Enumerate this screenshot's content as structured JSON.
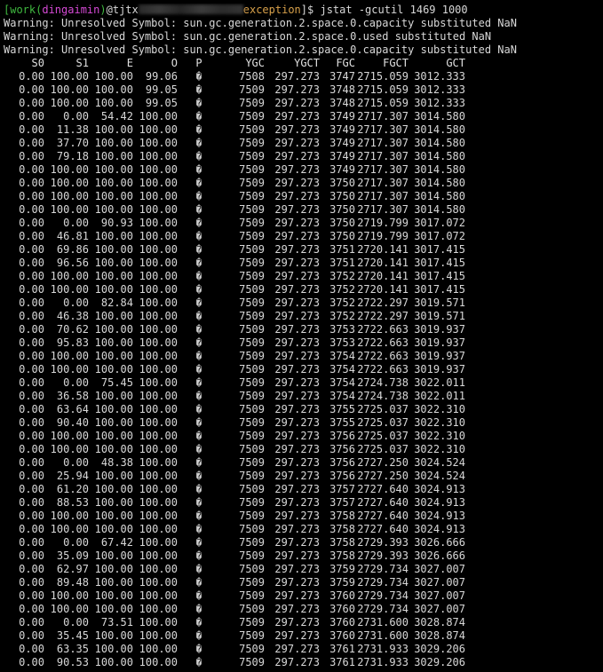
{
  "prompt": {
    "bracket_open": "[",
    "dir_a": "work(",
    "user": "dingaimin",
    "close_paren": ")",
    "at_host": "@tjtx",
    "dir_b": "exception",
    "bracket_close": "]$ ",
    "command": "jstat -gcutil 1469 1000"
  },
  "warnings": [
    "Warning: Unresolved Symbol: sun.gc.generation.2.space.0.capacity substituted NaN",
    "Warning: Unresolved Symbol: sun.gc.generation.2.space.0.used substituted NaN",
    "Warning: Unresolved Symbol: sun.gc.generation.2.space.0.capacity substituted NaN"
  ],
  "columns": [
    "S0",
    "S1",
    "E",
    "O",
    "P",
    "YGC",
    "YGCT",
    "FGC",
    "FGCT",
    "GCT"
  ],
  "p_glyph": "�",
  "rows": [
    [
      "0.00",
      "100.00",
      "100.00",
      "99.06",
      "7508",
      "297.273",
      "3747",
      "2715.059",
      "3012.333"
    ],
    [
      "0.00",
      "100.00",
      "100.00",
      "99.05",
      "7509",
      "297.273",
      "3748",
      "2715.059",
      "3012.333"
    ],
    [
      "0.00",
      "100.00",
      "100.00",
      "99.05",
      "7509",
      "297.273",
      "3748",
      "2715.059",
      "3012.333"
    ],
    [
      "0.00",
      "0.00",
      "54.42",
      "100.00",
      "7509",
      "297.273",
      "3749",
      "2717.307",
      "3014.580"
    ],
    [
      "0.00",
      "11.38",
      "100.00",
      "100.00",
      "7509",
      "297.273",
      "3749",
      "2717.307",
      "3014.580"
    ],
    [
      "0.00",
      "37.70",
      "100.00",
      "100.00",
      "7509",
      "297.273",
      "3749",
      "2717.307",
      "3014.580"
    ],
    [
      "0.00",
      "79.18",
      "100.00",
      "100.00",
      "7509",
      "297.273",
      "3749",
      "2717.307",
      "3014.580"
    ],
    [
      "0.00",
      "100.00",
      "100.00",
      "100.00",
      "7509",
      "297.273",
      "3749",
      "2717.307",
      "3014.580"
    ],
    [
      "0.00",
      "100.00",
      "100.00",
      "100.00",
      "7509",
      "297.273",
      "3750",
      "2717.307",
      "3014.580"
    ],
    [
      "0.00",
      "100.00",
      "100.00",
      "100.00",
      "7509",
      "297.273",
      "3750",
      "2717.307",
      "3014.580"
    ],
    [
      "0.00",
      "100.00",
      "100.00",
      "100.00",
      "7509",
      "297.273",
      "3750",
      "2717.307",
      "3014.580"
    ],
    [
      "0.00",
      "0.00",
      "90.93",
      "100.00",
      "7509",
      "297.273",
      "3750",
      "2719.799",
      "3017.072"
    ],
    [
      "0.00",
      "46.81",
      "100.00",
      "100.00",
      "7509",
      "297.273",
      "3750",
      "2719.799",
      "3017.072"
    ],
    [
      "0.00",
      "69.86",
      "100.00",
      "100.00",
      "7509",
      "297.273",
      "3751",
      "2720.141",
      "3017.415"
    ],
    [
      "0.00",
      "96.56",
      "100.00",
      "100.00",
      "7509",
      "297.273",
      "3751",
      "2720.141",
      "3017.415"
    ],
    [
      "0.00",
      "100.00",
      "100.00",
      "100.00",
      "7509",
      "297.273",
      "3752",
      "2720.141",
      "3017.415"
    ],
    [
      "0.00",
      "100.00",
      "100.00",
      "100.00",
      "7509",
      "297.273",
      "3752",
      "2720.141",
      "3017.415"
    ],
    [
      "0.00",
      "0.00",
      "82.84",
      "100.00",
      "7509",
      "297.273",
      "3752",
      "2722.297",
      "3019.571"
    ],
    [
      "0.00",
      "46.38",
      "100.00",
      "100.00",
      "7509",
      "297.273",
      "3752",
      "2722.297",
      "3019.571"
    ],
    [
      "0.00",
      "70.62",
      "100.00",
      "100.00",
      "7509",
      "297.273",
      "3753",
      "2722.663",
      "3019.937"
    ],
    [
      "0.00",
      "95.83",
      "100.00",
      "100.00",
      "7509",
      "297.273",
      "3753",
      "2722.663",
      "3019.937"
    ],
    [
      "0.00",
      "100.00",
      "100.00",
      "100.00",
      "7509",
      "297.273",
      "3754",
      "2722.663",
      "3019.937"
    ],
    [
      "0.00",
      "100.00",
      "100.00",
      "100.00",
      "7509",
      "297.273",
      "3754",
      "2722.663",
      "3019.937"
    ],
    [
      "0.00",
      "0.00",
      "75.45",
      "100.00",
      "7509",
      "297.273",
      "3754",
      "2724.738",
      "3022.011"
    ],
    [
      "0.00",
      "36.58",
      "100.00",
      "100.00",
      "7509",
      "297.273",
      "3754",
      "2724.738",
      "3022.011"
    ],
    [
      "0.00",
      "63.64",
      "100.00",
      "100.00",
      "7509",
      "297.273",
      "3755",
      "2725.037",
      "3022.310"
    ],
    [
      "0.00",
      "90.40",
      "100.00",
      "100.00",
      "7509",
      "297.273",
      "3755",
      "2725.037",
      "3022.310"
    ],
    [
      "0.00",
      "100.00",
      "100.00",
      "100.00",
      "7509",
      "297.273",
      "3756",
      "2725.037",
      "3022.310"
    ],
    [
      "0.00",
      "100.00",
      "100.00",
      "100.00",
      "7509",
      "297.273",
      "3756",
      "2725.037",
      "3022.310"
    ],
    [
      "0.00",
      "0.00",
      "48.38",
      "100.00",
      "7509",
      "297.273",
      "3756",
      "2727.250",
      "3024.524"
    ],
    [
      "0.00",
      "25.94",
      "100.00",
      "100.00",
      "7509",
      "297.273",
      "3756",
      "2727.250",
      "3024.524"
    ],
    [
      "0.00",
      "61.20",
      "100.00",
      "100.00",
      "7509",
      "297.273",
      "3757",
      "2727.640",
      "3024.913"
    ],
    [
      "0.00",
      "88.53",
      "100.00",
      "100.00",
      "7509",
      "297.273",
      "3757",
      "2727.640",
      "3024.913"
    ],
    [
      "0.00",
      "100.00",
      "100.00",
      "100.00",
      "7509",
      "297.273",
      "3758",
      "2727.640",
      "3024.913"
    ],
    [
      "0.00",
      "100.00",
      "100.00",
      "100.00",
      "7509",
      "297.273",
      "3758",
      "2727.640",
      "3024.913"
    ],
    [
      "0.00",
      "0.00",
      "67.42",
      "100.00",
      "7509",
      "297.273",
      "3758",
      "2729.393",
      "3026.666"
    ],
    [
      "0.00",
      "35.09",
      "100.00",
      "100.00",
      "7509",
      "297.273",
      "3758",
      "2729.393",
      "3026.666"
    ],
    [
      "0.00",
      "62.97",
      "100.00",
      "100.00",
      "7509",
      "297.273",
      "3759",
      "2729.734",
      "3027.007"
    ],
    [
      "0.00",
      "89.48",
      "100.00",
      "100.00",
      "7509",
      "297.273",
      "3759",
      "2729.734",
      "3027.007"
    ],
    [
      "0.00",
      "100.00",
      "100.00",
      "100.00",
      "7509",
      "297.273",
      "3760",
      "2729.734",
      "3027.007"
    ],
    [
      "0.00",
      "100.00",
      "100.00",
      "100.00",
      "7509",
      "297.273",
      "3760",
      "2729.734",
      "3027.007"
    ],
    [
      "0.00",
      "0.00",
      "73.51",
      "100.00",
      "7509",
      "297.273",
      "3760",
      "2731.600",
      "3028.874"
    ],
    [
      "0.00",
      "35.45",
      "100.00",
      "100.00",
      "7509",
      "297.273",
      "3760",
      "2731.600",
      "3028.874"
    ],
    [
      "0.00",
      "63.35",
      "100.00",
      "100.00",
      "7509",
      "297.273",
      "3761",
      "2731.933",
      "3029.206"
    ],
    [
      "0.00",
      "90.53",
      "100.00",
      "100.00",
      "7509",
      "297.273",
      "3761",
      "2731.933",
      "3029.206"
    ]
  ],
  "colors": {
    "background": "#000000",
    "text": "#d8d8d8",
    "prompt_green": "#3fb93f",
    "prompt_user_magenta": "#d64ad6",
    "prompt_dir_orange": "#d7a04a"
  }
}
